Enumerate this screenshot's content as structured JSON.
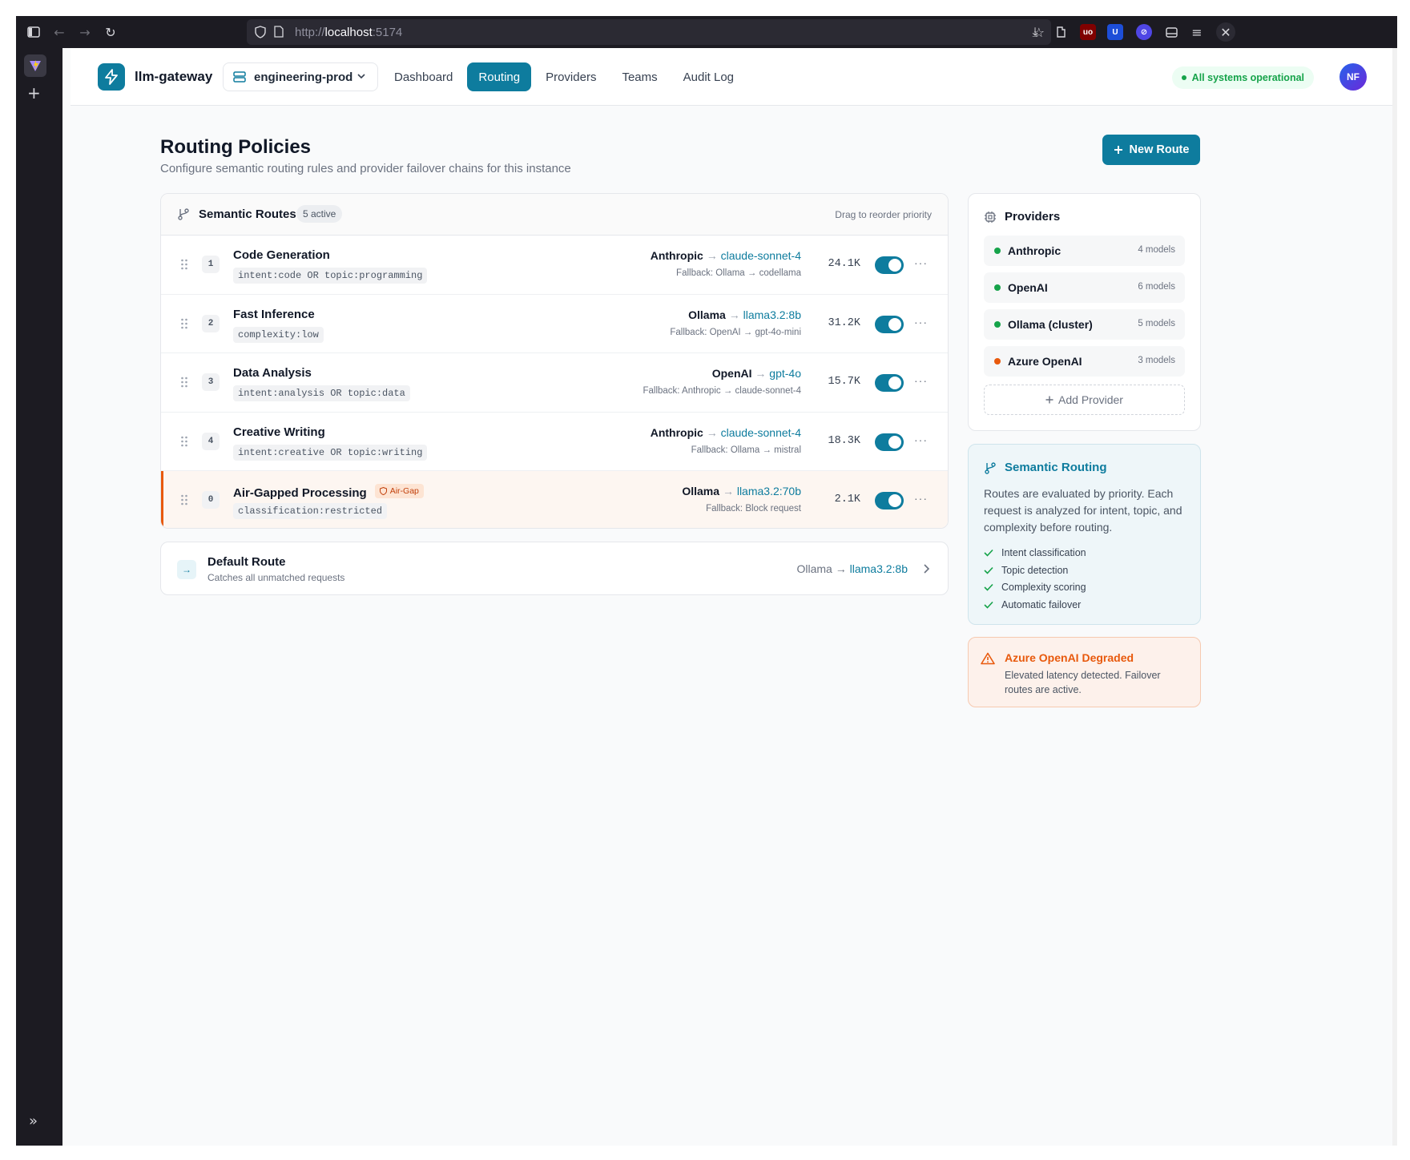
{
  "browser": {
    "url_scheme": "http://",
    "url_host": "localhost",
    "url_port": ":5174"
  },
  "header": {
    "brand": "llm-gateway",
    "environment": "engineering-prod",
    "nav": [
      "Dashboard",
      "Routing",
      "Providers",
      "Teams",
      "Audit Log"
    ],
    "active_nav": "Routing",
    "status": "All systems operational",
    "avatar_initials": "NF"
  },
  "page": {
    "title": "Routing Policies",
    "subtitle": "Configure semantic routing rules and provider failover chains for this instance",
    "new_route_label": "New Route"
  },
  "routes": {
    "title": "Semantic Routes",
    "badge": "5 active",
    "hint": "Drag to reorder priority",
    "items": [
      {
        "priority": "1",
        "name": "Code Generation",
        "rule": "intent:code OR topic:programming",
        "provider": "Anthropic",
        "arrow": "→",
        "model": "claude-sonnet-4",
        "fallback": "Fallback: Ollama → codellama",
        "count": "24.1K",
        "enabled": true
      },
      {
        "priority": "2",
        "name": "Fast Inference",
        "rule": "complexity:low",
        "provider": "Ollama",
        "arrow": "→",
        "model": "llama3.2:8b",
        "fallback": "Fallback: OpenAI → gpt-4o-mini",
        "count": "31.2K",
        "enabled": true
      },
      {
        "priority": "3",
        "name": "Data Analysis",
        "rule": "intent:analysis OR topic:data",
        "provider": "OpenAI",
        "arrow": "→",
        "model": "gpt-4o",
        "fallback": "Fallback: Anthropic → claude-sonnet-4",
        "count": "15.7K",
        "enabled": true
      },
      {
        "priority": "4",
        "name": "Creative Writing",
        "rule": "intent:creative OR topic:writing",
        "provider": "Anthropic",
        "arrow": "→",
        "model": "claude-sonnet-4",
        "fallback": "Fallback: Ollama → mistral",
        "count": "18.3K",
        "enabled": true
      },
      {
        "priority": "0",
        "name": "Air-Gapped Processing",
        "tag": "Air-Gap",
        "rule": "classification:restricted",
        "provider": "Ollama",
        "arrow": "→",
        "model": "llama3.2:70b",
        "fallback": "Fallback: Block request",
        "count": "2.1K",
        "enabled": true
      }
    ]
  },
  "default_route": {
    "title": "Default Route",
    "subtitle": "Catches all unmatched requests",
    "target": "Ollama →",
    "model": "llama3.2:8b"
  },
  "providers": {
    "title": "Providers",
    "items": [
      {
        "name": "Anthropic",
        "models": "4 models",
        "status_color": "#16a34a"
      },
      {
        "name": "OpenAI",
        "models": "6 models",
        "status_color": "#16a34a"
      },
      {
        "name": "Ollama (cluster)",
        "models": "5 models",
        "status_color": "#16a34a"
      },
      {
        "name": "Azure OpenAI",
        "models": "3 models",
        "status_color": "#e8590c"
      }
    ],
    "add_label": "Add Provider"
  },
  "semantic_info": {
    "title": "Semantic Routing",
    "body": "Routes are evaluated by priority. Each request is analyzed for intent, topic, and complexity before routing.",
    "features": [
      "Intent classification",
      "Topic detection",
      "Complexity scoring",
      "Automatic failover"
    ]
  },
  "alert": {
    "title": "Azure OpenAI Degraded",
    "body": "Elevated latency detected. Failover routes are active."
  },
  "colors": {
    "accent": "#0e7c9e",
    "success": "#16a34a",
    "warning": "#e8590c"
  }
}
